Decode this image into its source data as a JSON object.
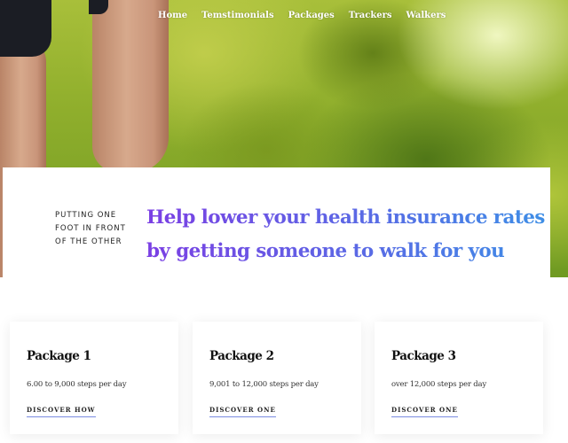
{
  "nav": {
    "items": [
      {
        "label": "Home"
      },
      {
        "label": "Temstimonials"
      },
      {
        "label": "Packages"
      },
      {
        "label": "Trackers"
      },
      {
        "label": "Walkers"
      }
    ]
  },
  "intro": {
    "tagline": "PUTTING ONE FOOT IN FRONT OF THE OTHER",
    "headline": "Help lower your health insurance rates by getting someone to walk for you",
    "gradient": [
      "#7b3fe4",
      "#3d8fe6"
    ]
  },
  "packages": [
    {
      "title": "Package 1",
      "description": "6.00 to 9,000 steps per day",
      "link": "DISCOVER HOW"
    },
    {
      "title": "Package 2",
      "description": "9,001 to 12,000 steps per day",
      "link": "DISCOVER ONE"
    },
    {
      "title": "Package 3",
      "description": "over 12,000 steps per day",
      "link": "DISCOVER ONE"
    }
  ]
}
